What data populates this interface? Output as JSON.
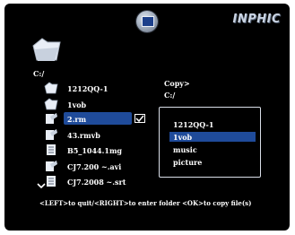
{
  "header": {
    "brand": "INPHIC",
    "top_icon": "media-player-icon"
  },
  "source": {
    "path": "C:/",
    "items": [
      {
        "name": "1212QQ-1",
        "icon": "folder-icon",
        "selected": false
      },
      {
        "name": "1vob",
        "icon": "folder-icon",
        "selected": false
      },
      {
        "name": "2.rm",
        "icon": "media-file-icon",
        "selected": true,
        "checked": true
      },
      {
        "name": "43.rmvb",
        "icon": "media-file-icon",
        "selected": false
      },
      {
        "name": "B5_1044.1mg",
        "icon": "document-icon",
        "selected": false
      },
      {
        "name": "CJ7.200 ~.avi",
        "icon": "media-file-icon",
        "selected": false
      },
      {
        "name": "CJ7.2008 ~.srt",
        "icon": "document-icon",
        "selected": false
      }
    ]
  },
  "destination": {
    "label": "Copy>",
    "path": "C:/",
    "items": [
      {
        "name": "1212QQ-1",
        "selected": false
      },
      {
        "name": "1vob",
        "selected": true
      },
      {
        "name": "music",
        "selected": false
      },
      {
        "name": "picture",
        "selected": false
      }
    ]
  },
  "hint": "<LEFT>to quit/<RIGHT>to enter folder <OK>to copy file(s)",
  "colors": {
    "background": "#000000",
    "highlight": "#1f4b9a",
    "text": "#ffffff"
  }
}
